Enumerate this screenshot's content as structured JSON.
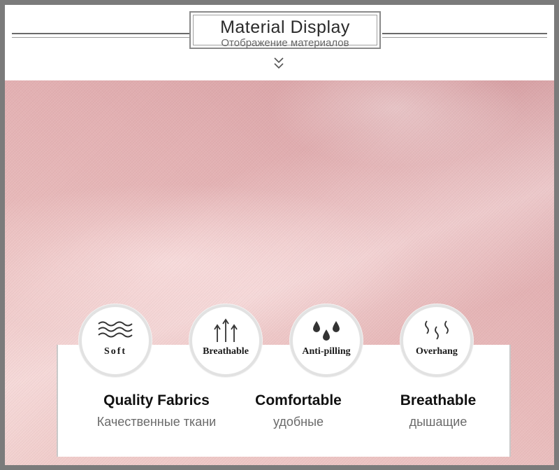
{
  "header": {
    "title": "Material Display",
    "subtitle": "Отображение материалов"
  },
  "colors": {
    "fabric": "#e3b1b3",
    "frame": "#7b7b7b",
    "text_dark": "#111111",
    "text_muted": "#6a6a6a"
  },
  "badges": [
    {
      "label": "Soft",
      "icon": "waves-icon"
    },
    {
      "label": "Breathable",
      "icon": "up-arrows-icon"
    },
    {
      "label": "Anti-pilling",
      "icon": "water-drops-icon"
    },
    {
      "label": "Overhang",
      "icon": "drape-curls-icon"
    }
  ],
  "features": [
    {
      "title": "Quality Fabrics",
      "subtitle": "Качественные ткани"
    },
    {
      "title": "Comfortable",
      "subtitle": "удобные"
    },
    {
      "title": "Breathable",
      "subtitle": "дышащие"
    }
  ]
}
